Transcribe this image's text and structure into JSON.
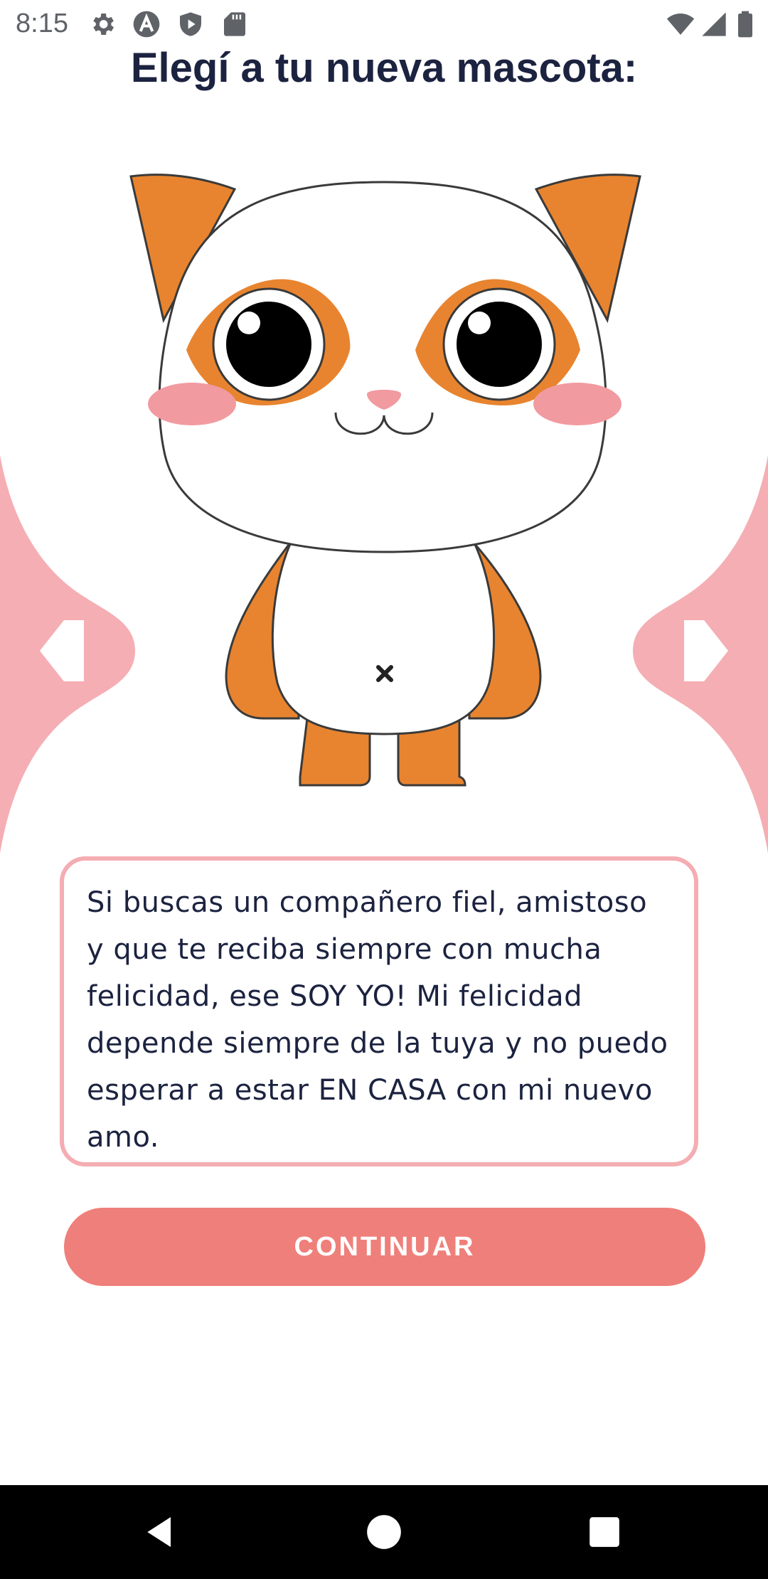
{
  "status_bar": {
    "time": "8:15",
    "icons": [
      "gear-icon",
      "a-icon",
      "shield-icon",
      "sd-card-icon",
      "wifi-icon",
      "signal-icon",
      "battery-icon"
    ]
  },
  "title": "Elegí a tu nueva mascota:",
  "pet": {
    "image": "cat-illustration",
    "description": "Si buscas un compañero fiel, amistoso y que te reciba siempre con mucha felicidad, ese SOY YO! Mi felicidad depende siempre de la tuya y no puedo esperar a estar EN CASA con mi nuevo amo."
  },
  "navigation": {
    "prev_icon": "arrow-left-icon",
    "next_icon": "arrow-right-icon"
  },
  "continue_label": "CONTINUAR",
  "colors": {
    "title": "#1c2340",
    "accent_pink": "#f4adb2",
    "button": "#ef7f7a",
    "cat_orange": "#e8842f",
    "cheek_pink": "#f19aa0"
  },
  "system_nav": [
    "back-icon",
    "home-icon",
    "recents-icon"
  ]
}
